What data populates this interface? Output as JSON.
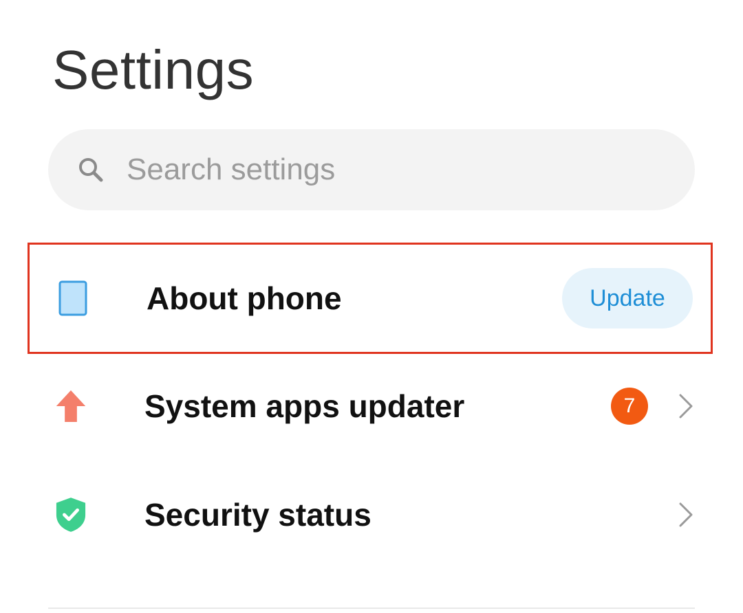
{
  "header": {
    "title": "Settings"
  },
  "search": {
    "placeholder": "Search settings",
    "icon": "search-icon"
  },
  "list": {
    "items": [
      {
        "label": "About phone",
        "icon": "phone-icon",
        "action_label": "Update",
        "highlighted": true
      },
      {
        "label": "System apps updater",
        "icon": "arrow-up-icon",
        "badge": "7"
      },
      {
        "label": "Security status",
        "icon": "shield-check-icon"
      }
    ]
  },
  "colors": {
    "highlight_border": "#e0341f",
    "update_pill_bg": "#e6f3fb",
    "update_pill_text": "#1e8ed6",
    "badge_bg": "#f25a12",
    "arrow_icon": "#f47f6b",
    "shield_icon": "#3ecf8e",
    "phone_icon_fill": "#bfe3fb",
    "phone_icon_stroke": "#3b9de0"
  }
}
